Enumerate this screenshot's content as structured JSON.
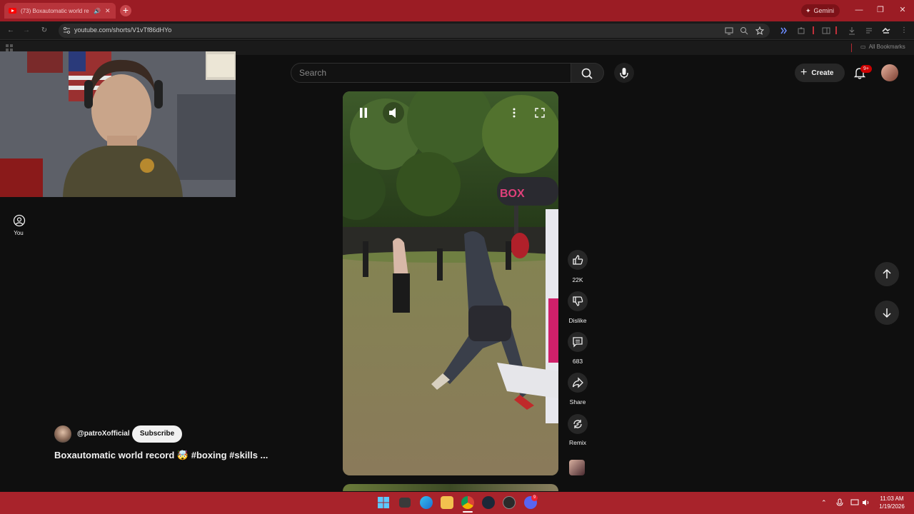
{
  "browser": {
    "tab_title": "(73) Boxautomatic world re",
    "new_tab": "+",
    "gemini_label": "Gemini",
    "url": "youtube.com/shorts/V1vTf86dHYo",
    "bookmarks_label": "All Bookmarks",
    "window_controls": [
      "—",
      "❐",
      "✕"
    ]
  },
  "youtube": {
    "search_placeholder": "Search",
    "create_label": "Create",
    "notifications_badge": "9+",
    "sidebar_you": "You",
    "actions": {
      "like_count": "22K",
      "dislike_label": "Dislike",
      "comments_count": "683",
      "share_label": "Share",
      "remix_label": "Remix"
    },
    "channel": "@patroXofficial",
    "subscribe_label": "Subscribe",
    "video_title": "Boxautomatic world record 🤯 #boxing #skills ...",
    "video_overlay_text": "BOX"
  },
  "taskbar": {
    "time": "11:03 AM",
    "date": "1/19/2026",
    "discord_badge": "9"
  },
  "colors": {
    "titlebar": "#9b1c24",
    "taskbar": "#a8232b",
    "youtube_bg": "#0f0f0f",
    "badge_red": "#cc0000"
  }
}
